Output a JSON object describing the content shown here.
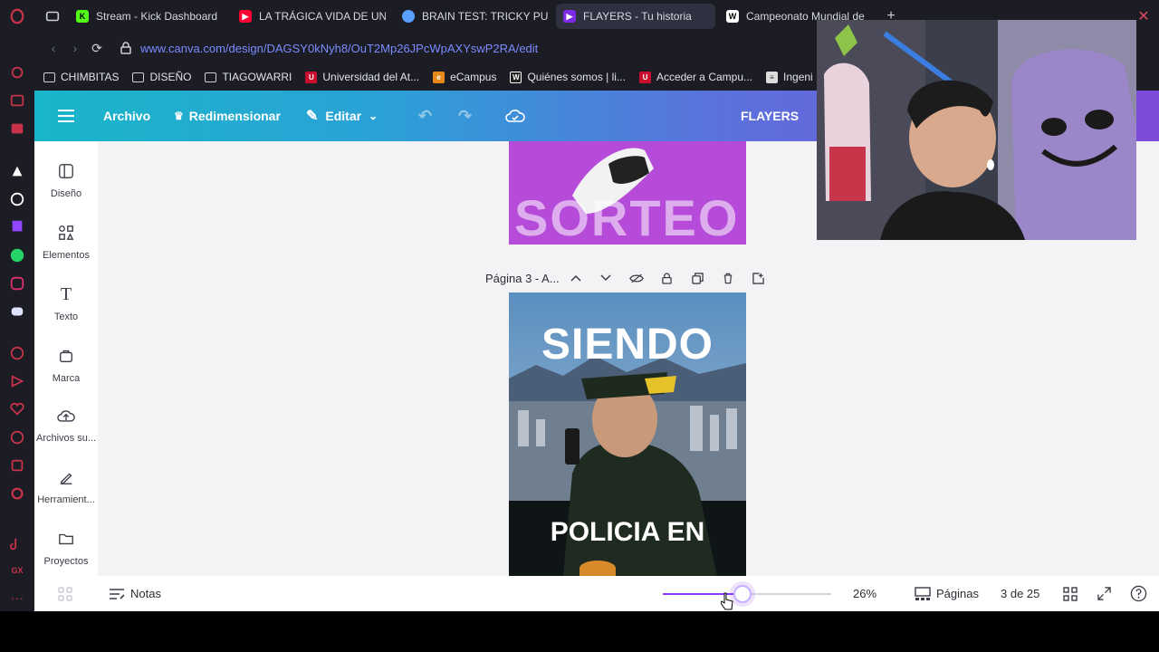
{
  "tabs": [
    {
      "label": "Stream - Kick Dashboard",
      "favicon": "kick-icon",
      "color": "#53fc18"
    },
    {
      "label": "LA TRÁGICA VIDA DE UN",
      "favicon": "youtube-icon",
      "color": "#ff0033"
    },
    {
      "label": "BRAIN TEST: TRICKY PU",
      "favicon": "game-icon",
      "color": "#5aa0ff"
    },
    {
      "label": "FLAYERS - Tu historia",
      "favicon": "canva-icon",
      "color": "#7d2ae8",
      "active": true
    },
    {
      "label": "Campeonato Mundial de",
      "favicon": "wix-icon",
      "color": "#ffffff"
    }
  ],
  "address": {
    "url": "www.canva.com/design/DAGSY0kNyh8/OuT2Mp26JPcWpAXYswP2RA/edit"
  },
  "bookmarks": [
    {
      "label": "CHIMBITAS",
      "type": "folder"
    },
    {
      "label": "DISEÑO",
      "type": "folder"
    },
    {
      "label": "TIAGOWARRI",
      "type": "folder"
    },
    {
      "label": "Universidad del At...",
      "type": "site",
      "color": "#c8102e"
    },
    {
      "label": "eCampus",
      "type": "site",
      "color": "#e88a1a"
    },
    {
      "label": "Quiénes somos | li...",
      "type": "site",
      "color": "#222222"
    },
    {
      "label": "Acceder a Campu...",
      "type": "site",
      "color": "#c8102e"
    },
    {
      "label": "Ingeni",
      "type": "site",
      "color": "#dddddd"
    }
  ],
  "canva_header": {
    "menu_icon": "hamburger-icon",
    "file": "Archivo",
    "resize": "Redimensionar",
    "edit": "Editar",
    "project_title": "FLAYERS"
  },
  "left_panel": [
    {
      "label": "Diseño",
      "icon": "layout-icon"
    },
    {
      "label": "Elementos",
      "icon": "shapes-icon"
    },
    {
      "label": "Texto",
      "icon": "text-icon"
    },
    {
      "label": "Marca",
      "icon": "brand-icon"
    },
    {
      "label": "Archivos su...",
      "icon": "cloud-upload-icon"
    },
    {
      "label": "Herramient...",
      "icon": "tools-icon"
    },
    {
      "label": "Proyectos",
      "icon": "folder-icon"
    }
  ],
  "canvas": {
    "page2_text": "SORTEO",
    "page3_label": "Página 3 - A...",
    "page3_headline": "SIENDO",
    "page3_subline": "POLICIA EN"
  },
  "bottom_bar": {
    "notes": "Notas",
    "zoom": "26%",
    "zoom_level": 0.26,
    "pages_label": "Páginas",
    "page_count": "3 de 25"
  },
  "colors": {
    "header_start": "#19b6c9",
    "header_end": "#7d4bd8",
    "page2_bg": "#b54bd8",
    "browser_bg": "#1b1c24"
  }
}
